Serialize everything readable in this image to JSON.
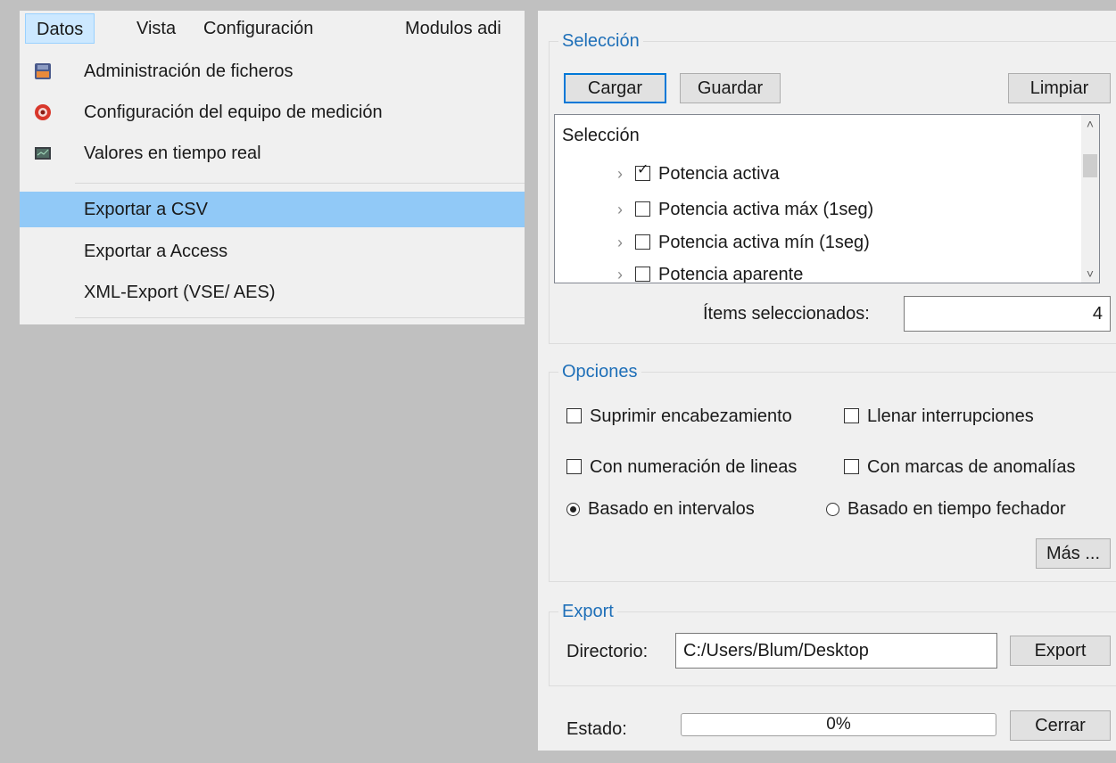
{
  "menubar": {
    "items": [
      "Datos",
      "Vista",
      "Configuración",
      "Modulos adi"
    ]
  },
  "menu": {
    "items": [
      {
        "label": "Administración de ficheros",
        "icon": "file-manager-icon"
      },
      {
        "label": "Configuración del equipo de medición",
        "icon": "device-config-icon"
      },
      {
        "label": "Valores en tiempo real",
        "icon": "realtime-monitor-icon"
      },
      {
        "label": "Exportar a CSV"
      },
      {
        "label": "Exportar a Access"
      },
      {
        "label": "XML-Export (VSE/ AES)"
      }
    ]
  },
  "selection": {
    "title": "Selección",
    "load_label": "Cargar",
    "save_label": "Guardar",
    "clear_label": "Limpiar",
    "tree_root": "Selección",
    "tree_items": [
      {
        "label": "Potencia activa",
        "checked": true
      },
      {
        "label": "Potencia activa máx (1seg)",
        "checked": false
      },
      {
        "label": "Potencia activa mín (1seg)",
        "checked": false
      },
      {
        "label": "Potencia aparente",
        "checked": false
      }
    ],
    "count_label": "Ítems seleccionados:",
    "count_value": "4"
  },
  "options": {
    "title": "Opciones",
    "suppress_header": "Suprimir encabezamiento",
    "fill_gaps": "Llenar interrupciones",
    "line_numbers": "Con numeración de lineas",
    "anomaly_marks": "Con marcas de anomalías",
    "interval_based": "Basado en intervalos",
    "timestamp_based": "Basado en tiempo fechador",
    "more_label": "Más ..."
  },
  "export": {
    "title": "Export",
    "dir_label": "Directorio:",
    "dir_value": "C:/Users/Blum/Desktop",
    "export_label": "Export"
  },
  "status": {
    "label": "Estado:",
    "progress": "0%",
    "close_label": "Cerrar"
  },
  "colors": {
    "accent": "#1e6fb8",
    "menu_highlight": "#91c9f7",
    "focus_border": "#0078d7"
  }
}
